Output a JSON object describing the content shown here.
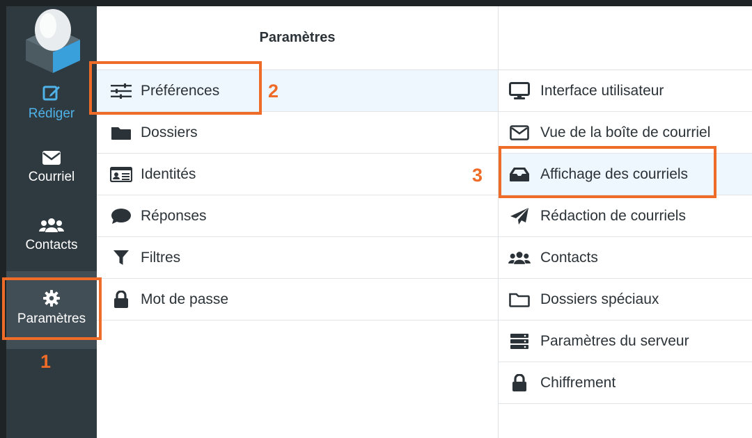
{
  "sidebar": {
    "items": [
      {
        "label": "Rédiger",
        "icon": "edit-icon"
      },
      {
        "label": "Courriel",
        "icon": "envelope-icon"
      },
      {
        "label": "Contacts",
        "icon": "users-icon"
      },
      {
        "label": "Paramètres",
        "icon": "gear-icon"
      }
    ]
  },
  "settings_menu": {
    "title": "Paramètres",
    "items": [
      {
        "label": "Préférences",
        "icon": "sliders-icon"
      },
      {
        "label": "Dossiers",
        "icon": "folder-icon"
      },
      {
        "label": "Identités",
        "icon": "id-card-icon"
      },
      {
        "label": "Réponses",
        "icon": "comment-icon"
      },
      {
        "label": "Filtres",
        "icon": "filter-icon"
      },
      {
        "label": "Mot de passe",
        "icon": "lock-icon"
      }
    ]
  },
  "preferences": {
    "items": [
      {
        "label": "Interface utilisateur",
        "icon": "monitor-icon"
      },
      {
        "label": "Vue de la boîte de courriel",
        "icon": "envelope-outline-icon"
      },
      {
        "label": "Affichage des courriels",
        "icon": "inbox-icon"
      },
      {
        "label": "Rédaction de courriels",
        "icon": "paper-plane-icon"
      },
      {
        "label": "Contacts",
        "icon": "users-icon"
      },
      {
        "label": "Dossiers spéciaux",
        "icon": "folder-outline-icon"
      },
      {
        "label": "Paramètres du serveur",
        "icon": "server-icon"
      },
      {
        "label": "Chiffrement",
        "icon": "lock-icon"
      }
    ]
  },
  "annotations": {
    "one": "1",
    "two": "2",
    "three": "3"
  },
  "colors": {
    "accent": "#ef6b28",
    "sidebar": "#2f3a40",
    "active": "#4fb2e9"
  }
}
